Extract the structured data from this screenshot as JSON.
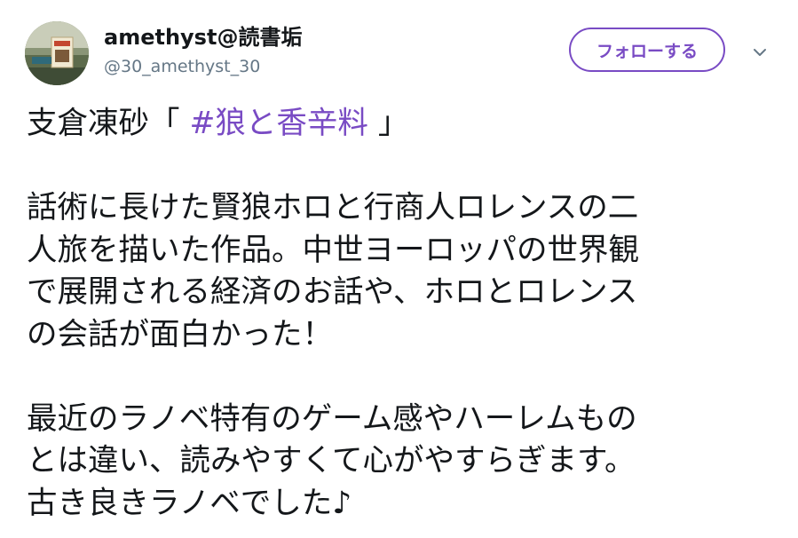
{
  "author": {
    "display_name": "amethyst@読書垢",
    "handle": "@30_amethyst_30"
  },
  "follow_button": {
    "label": "フォローする"
  },
  "menu": {
    "icon": "chevron-down-icon"
  },
  "tweet": {
    "line1_prefix": "支倉凍砂「 ",
    "hashtag": "#狼と香辛料",
    "line1_suffix": " 」",
    "para2_lines": [
      "話術に長けた賢狼ホロと行商人ロレンスの二",
      "人旅を描いた作品。中世ヨーロッパの世界観",
      "で展開される経済のお話や、ホロとロレンス",
      "の会話が面白かった！"
    ],
    "para3_lines": [
      "最近のラノベ特有のゲーム感やハーレムもの",
      "とは違い、読みやすくて心がやすらぎます。",
      "古き良きラノベでした♪"
    ]
  },
  "colors": {
    "accent": "#794bc4",
    "text": "#14171a",
    "secondary_text": "#657786"
  }
}
